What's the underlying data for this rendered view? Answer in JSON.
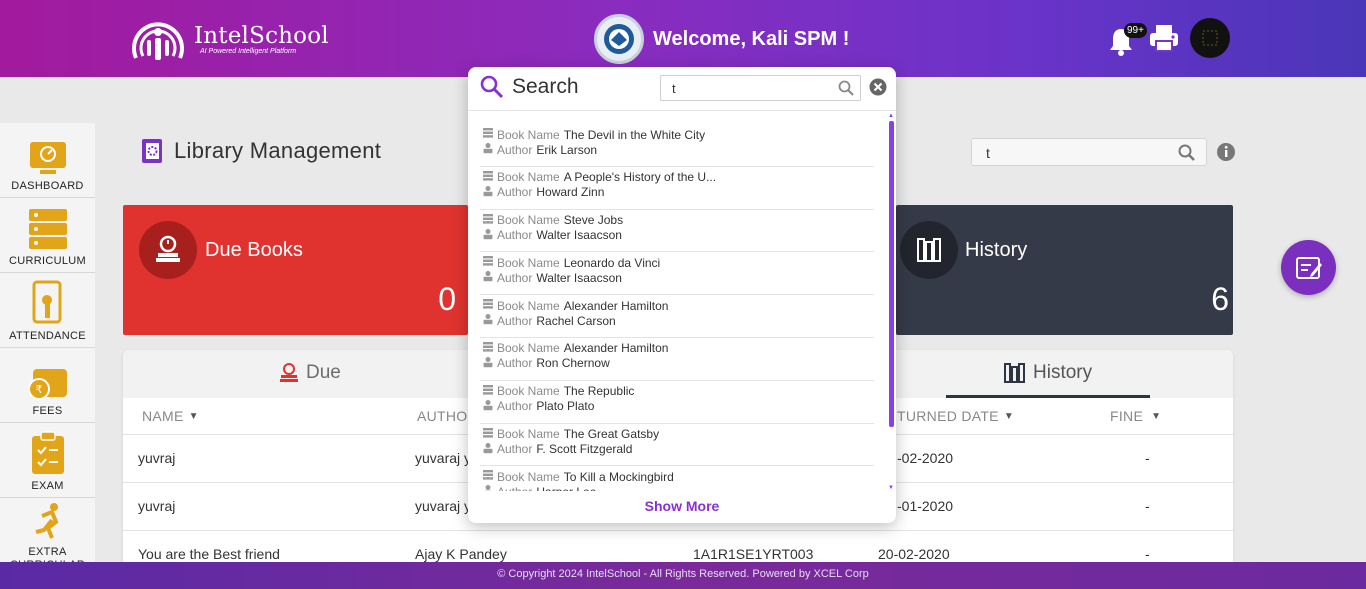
{
  "header": {
    "brand_name": "IntelSchool",
    "brand_tagline": "AI Powered Intelligent Platform",
    "welcome": "Welcome, Kali SPM !",
    "notification_count": "99+"
  },
  "sidebar": {
    "items": [
      {
        "label": "DASHBOARD",
        "icon": "dashboard-icon"
      },
      {
        "label": "CURRICULUM",
        "icon": "curriculum-icon"
      },
      {
        "label": "ATTENDANCE",
        "icon": "attendance-icon"
      },
      {
        "label": "FEES",
        "icon": "fees-icon"
      },
      {
        "label": "EXAM",
        "icon": "exam-icon"
      },
      {
        "label": "EXTRA CURRICULAR",
        "icon": "extra-curricular-icon"
      }
    ]
  },
  "page": {
    "title": "Library Management",
    "search_value": "t"
  },
  "cards": {
    "due_title": "Due Books",
    "due_count": "0",
    "history_title": "History",
    "history_count": "6"
  },
  "table": {
    "tabs": [
      "Due",
      "History"
    ],
    "columns": [
      "NAME",
      "AUTHO",
      "TURNED DATE",
      "FINE"
    ],
    "rows": [
      {
        "name": "yuvraj",
        "author": "yuvaraj y",
        "code": "",
        "date": "-02-2020",
        "fine": "-"
      },
      {
        "name": "yuvraj",
        "author": "yuvaraj y",
        "code": "",
        "date": "-01-2020",
        "fine": "-"
      },
      {
        "name": "You are the Best friend",
        "author": "Ajay K Pandey",
        "code": "1A1R1SE1YRT003",
        "date": "20-02-2020",
        "fine": "-"
      }
    ]
  },
  "search_modal": {
    "title": "Search",
    "input_value": "t",
    "book_label": "Book Name",
    "author_label": "Author",
    "results": [
      {
        "book": "The Devil in the White City",
        "author": "Erik Larson"
      },
      {
        "book": "A People's History of the U...",
        "author": "Howard Zinn"
      },
      {
        "book": "Steve Jobs",
        "author": "Walter Isaacson"
      },
      {
        "book": "Leonardo da Vinci",
        "author": "Walter Isaacson"
      },
      {
        "book": "Alexander Hamilton",
        "author": "Rachel Carson"
      },
      {
        "book": "Alexander Hamilton",
        "author": "Ron Chernow"
      },
      {
        "book": "The Republic",
        "author": "Plato Plato"
      },
      {
        "book": "The Great Gatsby",
        "author": "F. Scott Fitzgerald"
      },
      {
        "book": "To Kill a Mockingbird",
        "author": "Harper Lee"
      }
    ],
    "show_more": "Show More"
  },
  "footer": {
    "text": "© Copyright 2024 IntelSchool - All Rights Reserved. Powered by XCEL Corp"
  },
  "colors": {
    "brand_purple": "#8a2cbf",
    "due_red": "#e0332f",
    "history_dark": "#353a48",
    "accent_purple": "#8a2fd3",
    "icon_gold": "#e2a418"
  }
}
